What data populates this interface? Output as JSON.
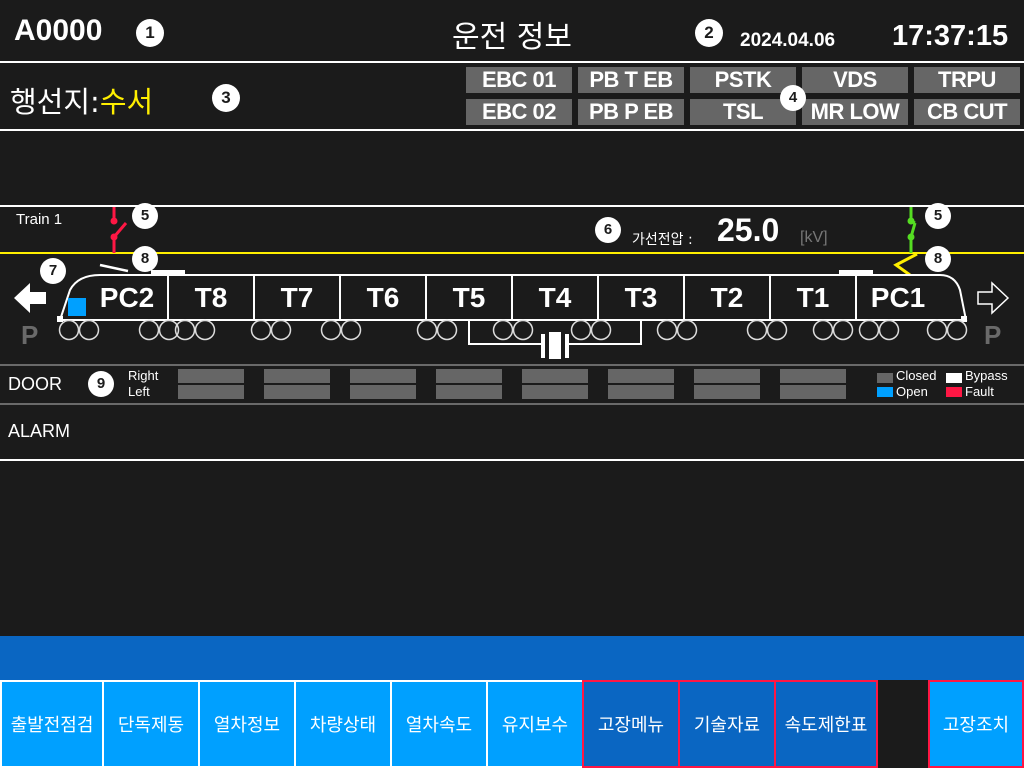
{
  "header": {
    "train_id": "A0000",
    "title": "운전 정보",
    "date": "2024.04.06",
    "time": "17:37:15"
  },
  "destination": {
    "label": "행선지:",
    "value": "수서"
  },
  "indicators": [
    {
      "label": "EBC 01"
    },
    {
      "label": "PB T EB"
    },
    {
      "label": "PSTK"
    },
    {
      "label": "VDS"
    },
    {
      "label": "TRPU"
    },
    {
      "label": "EBC 02"
    },
    {
      "label": "PB P EB"
    },
    {
      "label": "TSL"
    },
    {
      "label": "MR LOW"
    },
    {
      "label": "CB CUT"
    }
  ],
  "train": {
    "label": "Train 1",
    "voltage_label": "가선전압 :",
    "voltage_value": "25.0",
    "voltage_unit": "[kV]",
    "cars": [
      "PC2",
      "T8",
      "T7",
      "T6",
      "T5",
      "T4",
      "T3",
      "T2",
      "T1",
      "PC1"
    ],
    "park_left": "P",
    "park_right": "P",
    "left_breaker_color": "#ff1744",
    "right_breaker_color": "#55dd22",
    "catenary_color": "#ffef00"
  },
  "callouts": [
    "1",
    "2",
    "3",
    "4",
    "5",
    "6",
    "7",
    "8",
    "9"
  ],
  "door": {
    "label": "DOOR",
    "right_label": "Right",
    "left_label": "Left",
    "legend": [
      {
        "label": "Closed",
        "color": "#666666"
      },
      {
        "label": "Bypass",
        "color": "#ffffff"
      },
      {
        "label": "Open",
        "color": "#00a0ff"
      },
      {
        "label": "Fault",
        "color": "#ff1744"
      }
    ]
  },
  "alarm": {
    "label": "ALARM"
  },
  "menu": [
    {
      "label": "출발전점검"
    },
    {
      "label": "단독제동"
    },
    {
      "label": "열차정보"
    },
    {
      "label": "차량상태"
    },
    {
      "label": "열차속도"
    },
    {
      "label": "유지보수"
    },
    {
      "label": "고장메뉴"
    },
    {
      "label": "기술자료"
    },
    {
      "label": "속도제한표"
    },
    {
      "label": "고장조치"
    }
  ]
}
